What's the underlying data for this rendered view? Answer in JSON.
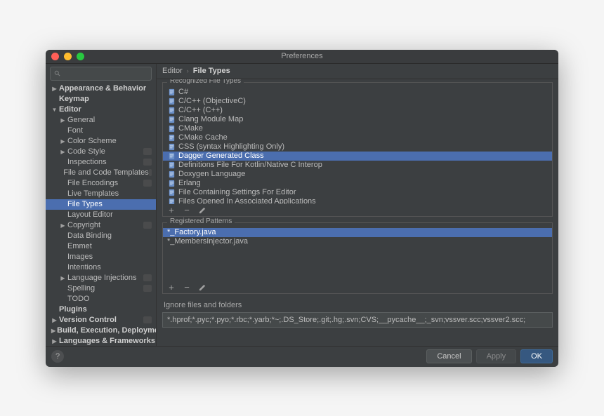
{
  "window": {
    "title": "Preferences"
  },
  "search": {
    "placeholder": ""
  },
  "breadcrumb": {
    "root": "Editor",
    "current": "File Types"
  },
  "sidebar": {
    "items": [
      {
        "label": "Appearance & Behavior",
        "bold": true,
        "arrow": "r",
        "indent": 0
      },
      {
        "label": "Keymap",
        "bold": true,
        "indent": 0,
        "pad": true
      },
      {
        "label": "Editor",
        "bold": true,
        "arrow": "d",
        "indent": 0
      },
      {
        "label": "General",
        "arrow": "r",
        "indent": 1
      },
      {
        "label": "Font",
        "indent": 1,
        "pad": true
      },
      {
        "label": "Color Scheme",
        "arrow": "r",
        "indent": 1
      },
      {
        "label": "Code Style",
        "arrow": "r",
        "indent": 1,
        "badge": true
      },
      {
        "label": "Inspections",
        "indent": 1,
        "pad": true,
        "badge": true
      },
      {
        "label": "File and Code Templates",
        "indent": 1,
        "pad": true,
        "badge": true
      },
      {
        "label": "File Encodings",
        "indent": 1,
        "pad": true,
        "badge": true
      },
      {
        "label": "Live Templates",
        "indent": 1,
        "pad": true
      },
      {
        "label": "File Types",
        "indent": 1,
        "pad": true,
        "selected": true
      },
      {
        "label": "Layout Editor",
        "indent": 1,
        "pad": true
      },
      {
        "label": "Copyright",
        "arrow": "r",
        "indent": 1,
        "badge": true
      },
      {
        "label": "Data Binding",
        "indent": 1,
        "pad": true
      },
      {
        "label": "Emmet",
        "indent": 1,
        "pad": true
      },
      {
        "label": "Images",
        "indent": 1,
        "pad": true
      },
      {
        "label": "Intentions",
        "indent": 1,
        "pad": true
      },
      {
        "label": "Language Injections",
        "arrow": "r",
        "indent": 1,
        "badge": true
      },
      {
        "label": "Spelling",
        "indent": 1,
        "pad": true,
        "badge": true
      },
      {
        "label": "TODO",
        "indent": 1,
        "pad": true
      },
      {
        "label": "Plugins",
        "bold": true,
        "indent": 0,
        "pad": true
      },
      {
        "label": "Version Control",
        "bold": true,
        "arrow": "r",
        "indent": 0,
        "badge": true
      },
      {
        "label": "Build, Execution, Deployment",
        "bold": true,
        "arrow": "r",
        "indent": 0
      },
      {
        "label": "Languages & Frameworks",
        "bold": true,
        "arrow": "r",
        "indent": 0
      }
    ]
  },
  "recognized": {
    "label": "Recognized File Types",
    "items": [
      {
        "label": "C#"
      },
      {
        "label": "C/C++ (ObjectiveC)"
      },
      {
        "label": "C/C++ (C++)"
      },
      {
        "label": "Clang Module Map"
      },
      {
        "label": "CMake"
      },
      {
        "label": "CMake Cache"
      },
      {
        "label": "CSS (syntax Highlighting Only)"
      },
      {
        "label": "Dagger Generated Class",
        "selected": true
      },
      {
        "label": "Definitions File For Kotlin/Native C Interop"
      },
      {
        "label": "Doxygen Language"
      },
      {
        "label": "Erlang"
      },
      {
        "label": "File Containing Settings For Editor"
      },
      {
        "label": "Files Opened In Associated Applications"
      }
    ]
  },
  "patterns": {
    "label": "Registered Patterns",
    "items": [
      {
        "label": "*_Factory.java",
        "selected": true
      },
      {
        "label": "*_MembersInjector.java"
      }
    ]
  },
  "ignore": {
    "label": "Ignore files and folders",
    "value": "*.hprof;*.pyc;*.pyo;*.rbc;*.yarb;*~;.DS_Store;.git;.hg;.svn;CVS;__pycache__;_svn;vssver.scc;vssver2.scc;"
  },
  "footer": {
    "cancel": "Cancel",
    "apply": "Apply",
    "ok": "OK"
  }
}
